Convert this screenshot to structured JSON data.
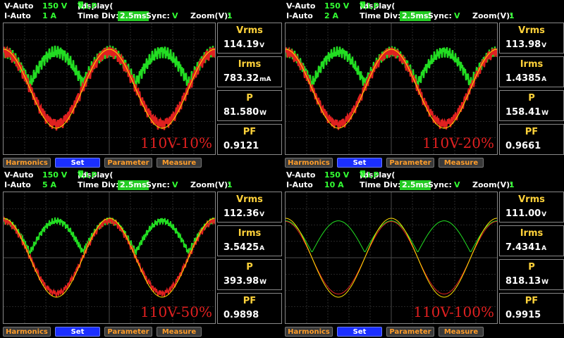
{
  "labels": {
    "v_range": "V-Auto",
    "i_range": "I-Auto",
    "display": "Display(",
    "v_letter": "V:",
    "i_letter": "I:",
    "p_letter": "P:",
    "display_close": "):",
    "display_vals": "V,I,P",
    "time_div": "Time Div:",
    "sync": "Sync:",
    "sync_val": "V",
    "zoom": "Zoom(V):",
    "zoom_val": "1"
  },
  "colors": {
    "voltage": "#ffe000",
    "current": "#e02020",
    "power": "#22dd22"
  },
  "buttons": {
    "harmonics": "Harmonics",
    "set": "Set",
    "parameter": "Parameter",
    "measure": "Measure"
  },
  "meas_labels": {
    "vrms": "Vrms",
    "irms": "Irms",
    "p": "P",
    "pf": "PF"
  },
  "panels": [
    {
      "v_range_val": "150 V",
      "i_range_val": "1 A",
      "time_div_val": "2.5ms",
      "tag": "110V-10%",
      "vrms": "114.19",
      "vrms_unit": "V",
      "irms": "783.32",
      "irms_unit": "mA",
      "p": "81.580",
      "p_unit": "W",
      "pf": "0.9121"
    },
    {
      "v_range_val": "150 V",
      "i_range_val": "2 A",
      "time_div_val": "2.5ms",
      "tag": "110V-20%",
      "vrms": "113.98",
      "vrms_unit": "V",
      "irms": "1.4385",
      "irms_unit": "A",
      "p": "158.41",
      "p_unit": "W",
      "pf": "0.9661"
    },
    {
      "v_range_val": "150 V",
      "i_range_val": "5 A",
      "time_div_val": "2.5ms",
      "tag": "110V-50%",
      "vrms": "112.36",
      "vrms_unit": "V",
      "irms": "3.5425",
      "irms_unit": "A",
      "p": "393.98",
      "p_unit": "W",
      "pf": "0.9898"
    },
    {
      "v_range_val": "150 V",
      "i_range_val": "10 A",
      "time_div_val": "2.5ms",
      "tag": "110V-100%",
      "vrms": "111.00",
      "vrms_unit": "V",
      "irms": "7.4341",
      "irms_unit": "A",
      "p": "818.13",
      "p_unit": "W",
      "pf": "0.9915"
    }
  ]
}
